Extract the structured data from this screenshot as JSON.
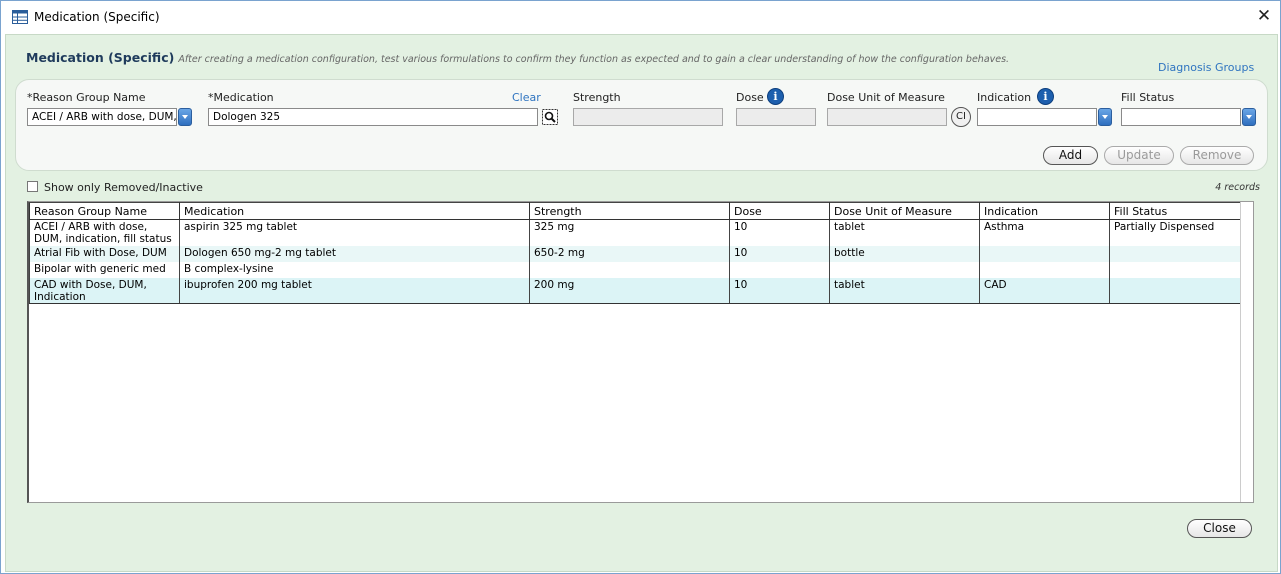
{
  "window": {
    "title": "Medication (Specific)"
  },
  "heading": {
    "title": "Medication (Specific)",
    "description": "After creating a medication configuration, test various formulations to confirm they function as expected and to gain a clear understanding of how the configuration behaves."
  },
  "links": {
    "diagnosis_groups": "Diagnosis Groups",
    "clear": "Clear"
  },
  "form": {
    "reason_group": {
      "label": "*Reason Group Name",
      "value": "ACEI / ARB with dose, DUM, i"
    },
    "medication": {
      "label": "*Medication",
      "value": "Dologen 325"
    },
    "strength": {
      "label": "Strength",
      "value": ""
    },
    "dose": {
      "label": "Dose",
      "value": ""
    },
    "dose_unit": {
      "label": "Dose Unit of Measure",
      "value": "",
      "ci_label": "CI"
    },
    "indication": {
      "label": "Indication",
      "value": ""
    },
    "fill_status": {
      "label": "Fill Status",
      "value": ""
    }
  },
  "buttons": {
    "add": "Add",
    "update": "Update",
    "remove": "Remove",
    "close": "Close"
  },
  "filter": {
    "show_removed_label": "Show only Removed/Inactive",
    "checked": false
  },
  "record_count": "4 records",
  "table": {
    "columns": [
      "Reason Group Name",
      "Medication",
      "Strength",
      "Dose",
      "Dose Unit of Measure",
      "Indication",
      "Fill Status"
    ],
    "rows": [
      [
        "ACEI / ARB with dose, DUM, indication, fill status",
        "aspirin 325 mg tablet",
        "325 mg",
        "10",
        "tablet",
        "Asthma",
        "Partially Dispensed"
      ],
      [
        "Atrial Fib with Dose, DUM",
        "Dologen 650 mg-2 mg tablet",
        "650-2 mg",
        "10",
        "bottle",
        "",
        ""
      ],
      [
        "Bipolar with generic med",
        "B complex-lysine",
        "",
        "",
        "",
        "",
        ""
      ],
      [
        "CAD with Dose, DUM, Indication",
        "ibuprofen 200 mg tablet",
        "200 mg",
        "10",
        "tablet",
        "CAD",
        ""
      ]
    ]
  },
  "icons": {
    "title": "table-grid-icon",
    "close": "close-icon",
    "info": "info-icon",
    "search": "search-icon",
    "dropdown": "chevron-down-icon"
  },
  "colors": {
    "accent": "#1d5fae",
    "link": "#2f74c0",
    "panel_bg": "#e3f1e2",
    "row_alt": "#e9f7f7"
  }
}
